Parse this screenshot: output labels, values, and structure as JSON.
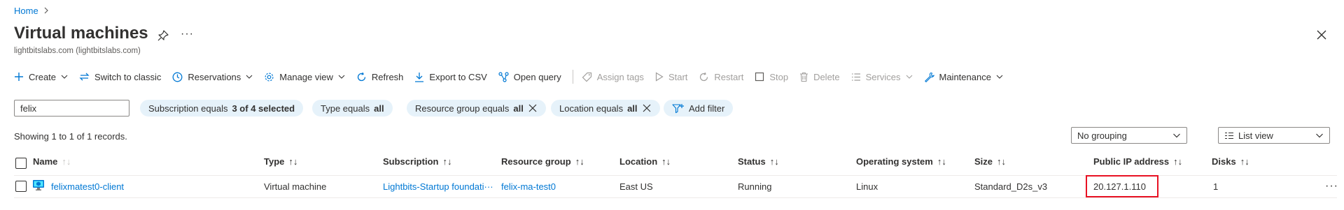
{
  "breadcrumb": {
    "home": "Home",
    "separator": ">"
  },
  "header": {
    "title": "Virtual machines",
    "subtitle": "lightbitslabs.com (lightbitslabs.com)",
    "more": "···"
  },
  "toolbar": {
    "create": "Create",
    "switch_classic": "Switch to classic",
    "reservations": "Reservations",
    "manage_view": "Manage view",
    "refresh": "Refresh",
    "export_csv": "Export to CSV",
    "open_query": "Open query",
    "assign_tags": "Assign tags",
    "start": "Start",
    "restart": "Restart",
    "stop": "Stop",
    "delete": "Delete",
    "services": "Services",
    "maintenance": "Maintenance"
  },
  "filters": {
    "search_value": "felix",
    "subscription_label": "Subscription equals",
    "subscription_value": "3 of 4 selected",
    "type_label": "Type equals",
    "type_value": "all",
    "resource_group_label": "Resource group equals",
    "resource_group_value": "all",
    "location_label": "Location equals",
    "location_value": "all",
    "add_filter": "Add filter"
  },
  "records": "Showing 1 to 1 of 1 records.",
  "grouping": "No grouping",
  "view": "List view",
  "table": {
    "columns": {
      "name": "Name",
      "type": "Type",
      "subscription": "Subscription",
      "resource_group": "Resource group",
      "location": "Location",
      "status": "Status",
      "os": "Operating system",
      "size": "Size",
      "public_ip": "Public IP address",
      "disks": "Disks"
    },
    "sort_glyph": "↑↓",
    "rows": [
      {
        "name": "felixmatest0-client",
        "type": "Virtual machine",
        "subscription": "Lightbits-Startup foundati···",
        "resource_group": "felix-ma-test0",
        "location": "East US",
        "status": "Running",
        "os": "Linux",
        "size": "Standard_D2s_v3",
        "public_ip": "20.127.1.110",
        "disks": "1",
        "more": "···"
      }
    ]
  },
  "colors": {
    "accent": "#0078d4",
    "pill_bg": "#e6f2fa",
    "highlight": "#e81123",
    "text": "#323130",
    "disabled": "#a19f9d"
  }
}
